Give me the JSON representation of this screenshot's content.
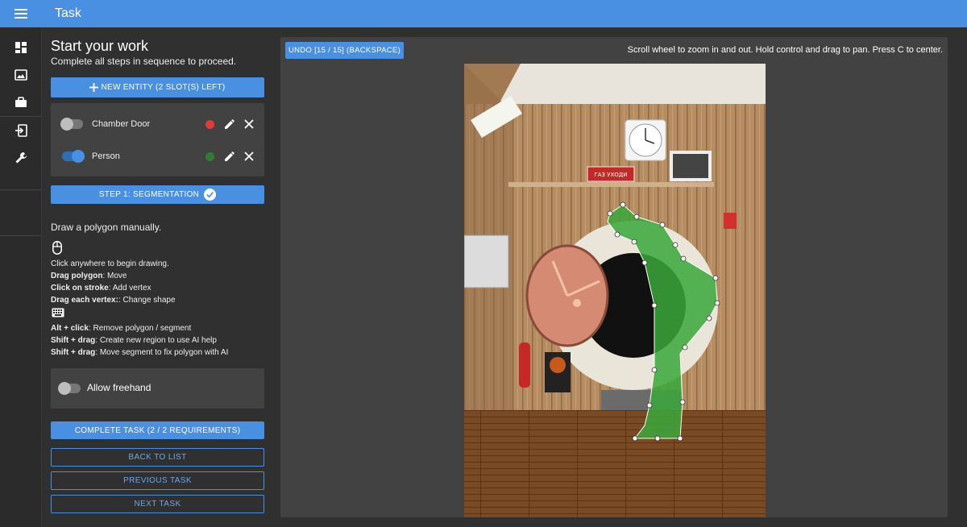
{
  "app": {
    "title": "Task"
  },
  "panel": {
    "title": "Start your work",
    "subtitle": "Complete all steps in sequence to proceed.",
    "new_entity_label": "NEW ENTITY (2 SLOT(S) LEFT)",
    "entities": [
      {
        "label": "Chamber Door",
        "color": "#e53935",
        "enabled": false
      },
      {
        "label": "Person",
        "color": "#2e7d32",
        "enabled": true
      }
    ],
    "step_label": "STEP 1: SEGMENTATION",
    "instructions": {
      "heading": "Draw a polygon manually.",
      "mouse_icon": "mouse-icon",
      "keyboard_icon": "keyboard-icon",
      "lines": [
        {
          "bold": "",
          "text": "Click anywhere to begin drawing."
        },
        {
          "bold": "Drag polygon",
          "text": ": Move"
        },
        {
          "bold": "Click on stroke",
          "text": ": Add vertex"
        },
        {
          "bold": "Drag each vertex:",
          "text": ": Change shape"
        },
        {
          "bold": "Alt + click",
          "text": ": Remove polygon / segment"
        },
        {
          "bold": "Shift + drag",
          "text": ": Create new region to use AI help"
        },
        {
          "bold": "Shift + drag",
          "text": ": Move segment to fix polygon with AI"
        }
      ]
    },
    "freehand_label": "Allow freehand",
    "complete_label": "COMPLETE TASK (2 / 2 REQUIREMENTS)",
    "back_label": "BACK TO LIST",
    "previous_label": "PREVIOUS TASK",
    "next_label": "NEXT TASK"
  },
  "canvas": {
    "undo_label": "UNDO [15 / 15] (BACKSPACE)",
    "hint": "Scroll wheel to zoom in and out. Hold control and drag to pan. Press C to center.",
    "sign_text": "ГАЗ УХОДИ"
  },
  "colors": {
    "accent": "#4a90e2",
    "polygon": "#3aa83a"
  }
}
